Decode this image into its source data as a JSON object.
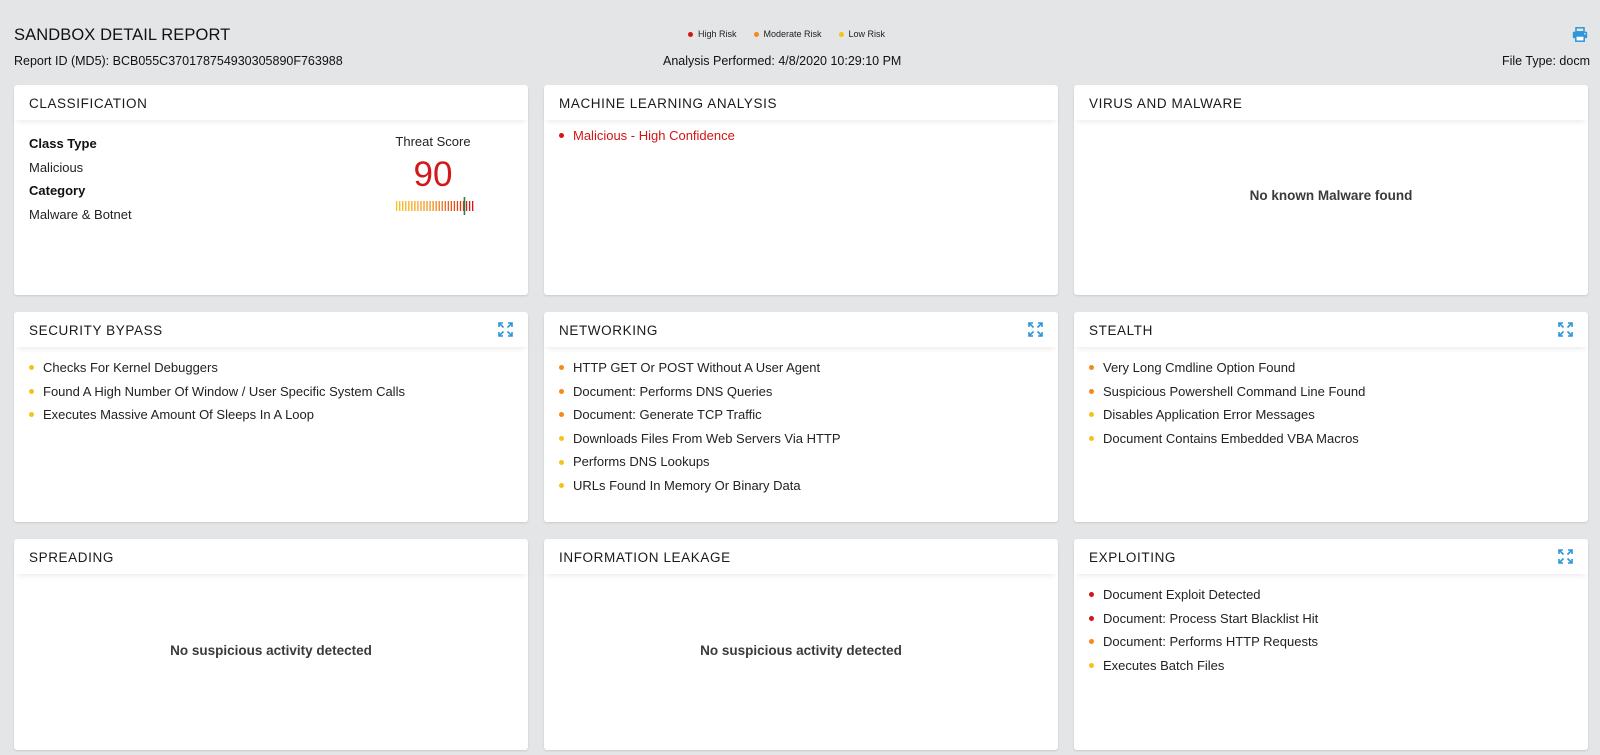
{
  "header": {
    "title": "SANDBOX DETAIL REPORT",
    "report_id": "Report ID (MD5): BCB055C370178754930305890F763988",
    "analysis": "Analysis Performed: 4/8/2020 10:29:10 PM",
    "file_type": "File Type: docm",
    "print_icon": "printer-icon"
  },
  "legend": [
    {
      "label": "High Risk",
      "color": "#d41515"
    },
    {
      "label": "Moderate Risk",
      "color": "#f28a1d"
    },
    {
      "label": "Low Risk",
      "color": "#f5c21a"
    }
  ],
  "colors": {
    "high": "#d41515",
    "moderate": "#f28a1d",
    "low": "#f5c21a",
    "accent": "#2f97d8",
    "score": "#d11919"
  },
  "classification": {
    "title": "CLASSIFICATION",
    "class_type_label": "Class Type",
    "class_type_value": "Malicious",
    "category_label": "Category",
    "category_value": "Malware & Botnet",
    "threat_label": "Threat Score",
    "threat_score": "90",
    "threat_fraction": 0.9
  },
  "ml": {
    "title": "MACHINE LEARNING ANALYSIS",
    "items": [
      {
        "text": "Malicious - High Confidence",
        "risk": "high"
      }
    ]
  },
  "virus": {
    "title": "VIRUS AND MALWARE",
    "empty": "No known Malware found"
  },
  "security_bypass": {
    "title": "SECURITY BYPASS",
    "items": [
      {
        "text": "Checks For Kernel Debuggers",
        "risk": "low"
      },
      {
        "text": "Found A High Number Of Window / User Specific System Calls",
        "risk": "low"
      },
      {
        "text": "Executes Massive Amount Of Sleeps In A Loop",
        "risk": "low"
      }
    ]
  },
  "networking": {
    "title": "NETWORKING",
    "items": [
      {
        "text": "HTTP GET Or POST Without A User Agent",
        "risk": "moderate"
      },
      {
        "text": "Document: Performs DNS Queries",
        "risk": "moderate"
      },
      {
        "text": "Document: Generate TCP Traffic",
        "risk": "moderate"
      },
      {
        "text": "Downloads Files From Web Servers Via HTTP",
        "risk": "low"
      },
      {
        "text": "Performs DNS Lookups",
        "risk": "low"
      },
      {
        "text": "URLs Found In Memory Or Binary Data",
        "risk": "low"
      }
    ]
  },
  "stealth": {
    "title": "STEALTH",
    "items": [
      {
        "text": "Very Long Cmdline Option Found",
        "risk": "moderate"
      },
      {
        "text": "Suspicious Powershell Command Line Found",
        "risk": "moderate"
      },
      {
        "text": "Disables Application Error Messages",
        "risk": "low"
      },
      {
        "text": "Document Contains Embedded VBA Macros",
        "risk": "low"
      }
    ]
  },
  "spreading": {
    "title": "SPREADING",
    "empty": "No suspicious activity detected"
  },
  "info_leakage": {
    "title": "INFORMATION LEAKAGE",
    "empty": "No suspicious activity detected"
  },
  "exploiting": {
    "title": "EXPLOITING",
    "items": [
      {
        "text": "Document Exploit Detected",
        "risk": "high"
      },
      {
        "text": "Document: Process Start Blacklist Hit",
        "risk": "high"
      },
      {
        "text": "Document: Performs HTTP Requests",
        "risk": "moderate"
      },
      {
        "text": "Executes Batch Files",
        "risk": "low"
      }
    ]
  }
}
